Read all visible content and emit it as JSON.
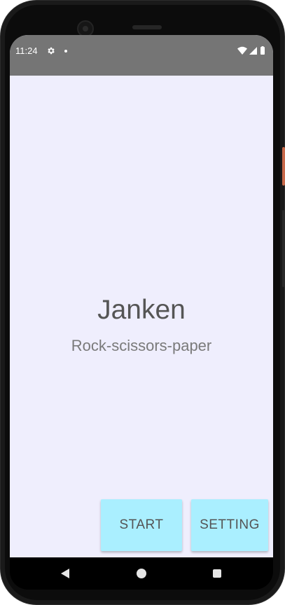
{
  "status_bar": {
    "time": "11:24",
    "icons": [
      "gear-icon",
      "notification-dot-icon",
      "wifi-icon",
      "signal-icon",
      "battery-icon"
    ]
  },
  "main": {
    "title": "Janken",
    "subtitle": "Rock-scissors-paper"
  },
  "buttons": {
    "start_label": "START",
    "setting_label": "SETTING"
  },
  "nav_bar": {
    "icons": [
      "back-icon",
      "home-icon",
      "recents-icon"
    ]
  },
  "colors": {
    "background": "#efeefd",
    "status_bar": "#757575",
    "button": "#aaefff",
    "title_text": "#555555",
    "subtitle_text": "#7a7a7a"
  }
}
